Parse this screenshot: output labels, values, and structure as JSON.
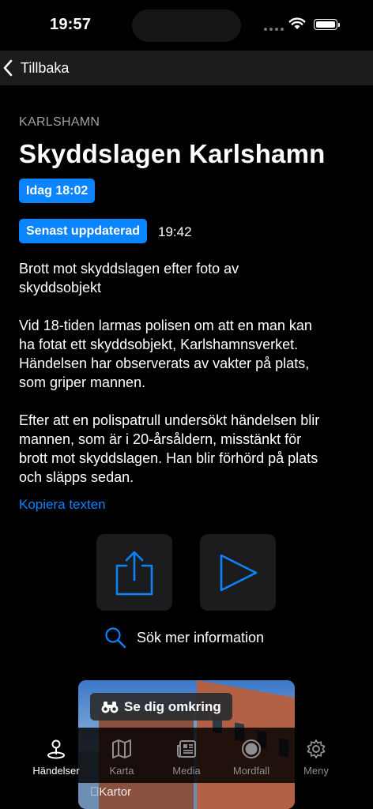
{
  "status_bar": {
    "time": "19:57"
  },
  "nav": {
    "back_label": "Tillbaka"
  },
  "event": {
    "area": "KARLSHAMN",
    "title": "Skyddslagen Karlshamn",
    "date_badge": "Idag 18:02",
    "updated_badge": "Senast uppdaterad",
    "updated_time": "19:42",
    "paragraphs": [
      "Brott mot skyddslagen efter foto av\nskyddsobjekt",
      "Vid 18-tiden larmas polisen om att en man kan\nha fotat ett skyddsobjekt, Karlshamnsverket.\nHändelsen har observerats av vakter på plats,\nsom griper mannen.",
      "Efter att en polispatrull undersökt händelsen blir\nmannen, som är i 20-årsåldern, misstänkt för\nbrott mot skyddslagen. Han blir förhörd på plats\noch släpps sedan."
    ],
    "copy_label": "Kopiera texten"
  },
  "actions": {
    "share_icon": "share-icon",
    "play_icon": "play-icon"
  },
  "search_more": {
    "label": "Sök mer information"
  },
  "map_card": {
    "lookaround_label": "Se dig omkring",
    "maps_label": "Kartor"
  },
  "tabs": [
    {
      "label": "Händelser",
      "icon": "pin-icon",
      "active": true
    },
    {
      "label": "Karta",
      "icon": "map-icon",
      "active": false
    },
    {
      "label": "Media",
      "icon": "newspaper-icon",
      "active": false
    },
    {
      "label": "Mordfall",
      "icon": "record-icon",
      "active": false
    },
    {
      "label": "Meny",
      "icon": "gear-icon",
      "active": false
    }
  ],
  "colors": {
    "accent": "#0a84ff",
    "background": "#000000",
    "secondary_text": "#a1a1a6",
    "nav_bg": "#1c1c1e"
  }
}
